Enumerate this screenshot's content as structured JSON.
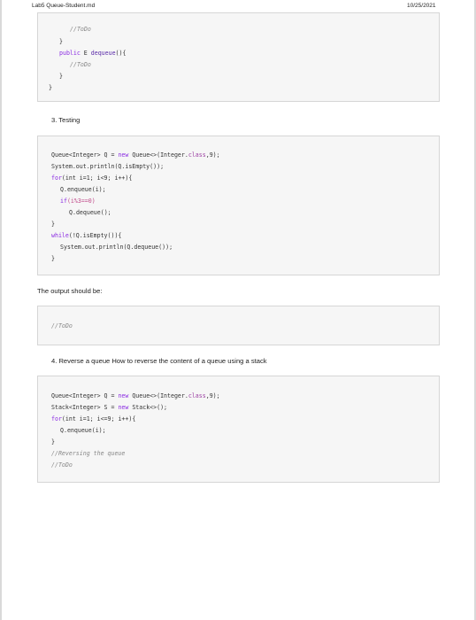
{
  "header": {
    "file_name": "Lab5 Queue-Student.md",
    "date": "10/25/2021"
  },
  "box1": {
    "lines": [
      {
        "indent": 5,
        "text": "//ToDo",
        "kind": "comment"
      },
      {
        "indent": 4,
        "text": "}",
        "kind": "plain"
      },
      {
        "indent": 4,
        "text": "public E dequeue(){",
        "kind": "sig"
      },
      {
        "indent": 5,
        "text": "//ToDo",
        "kind": "comment"
      },
      {
        "indent": 4,
        "text": "}",
        "kind": "plain"
      },
      {
        "indent": 2,
        "text": "}",
        "kind": "plain"
      }
    ]
  },
  "section3": {
    "heading": "3. Testing"
  },
  "box2": {
    "l1_a": "Queue<Integer> Q = ",
    "l1_new": "new",
    "l1_b": " Queue<>(Integer.",
    "l1_class": "class",
    "l1_c": ",9);",
    "l2": "System.out.println(Q.isEmpty());",
    "l3_for": "for",
    "l3_rest": "(int i=1; i<9; i++){",
    "l4": "Q.enqueue(i);",
    "l5_if": "if",
    "l5_rest": "(i%3==0)",
    "l6": "Q.dequeue();",
    "l7": "}",
    "l8_while": "while",
    "l8_rest": "(!Q.isEmpty()){",
    "l9": "System.out.println(Q.dequeue());",
    "l10": "}"
  },
  "output": {
    "label": "The output should be:",
    "todo": "//ToDo"
  },
  "section4": {
    "heading": "4. Reverse a queue How to reverse the content of a queue using a stack"
  },
  "box4": {
    "l1_a": "Queue<Integer> Q = ",
    "l1_new": "new",
    "l1_b": " Queue<>(Integer.",
    "l1_class": "class",
    "l1_c": ",9);",
    "l2_a": "Stack<Integer> S = ",
    "l2_new": "new",
    "l2_b": " Stack<>();",
    "l3_for": "for",
    "l3_rest": "(int i=1; i<=9; i++){",
    "l4": "Q.enqueue(i);",
    "l5": "}",
    "l6": "//Reversing the queue",
    "l7": "//ToDo"
  }
}
